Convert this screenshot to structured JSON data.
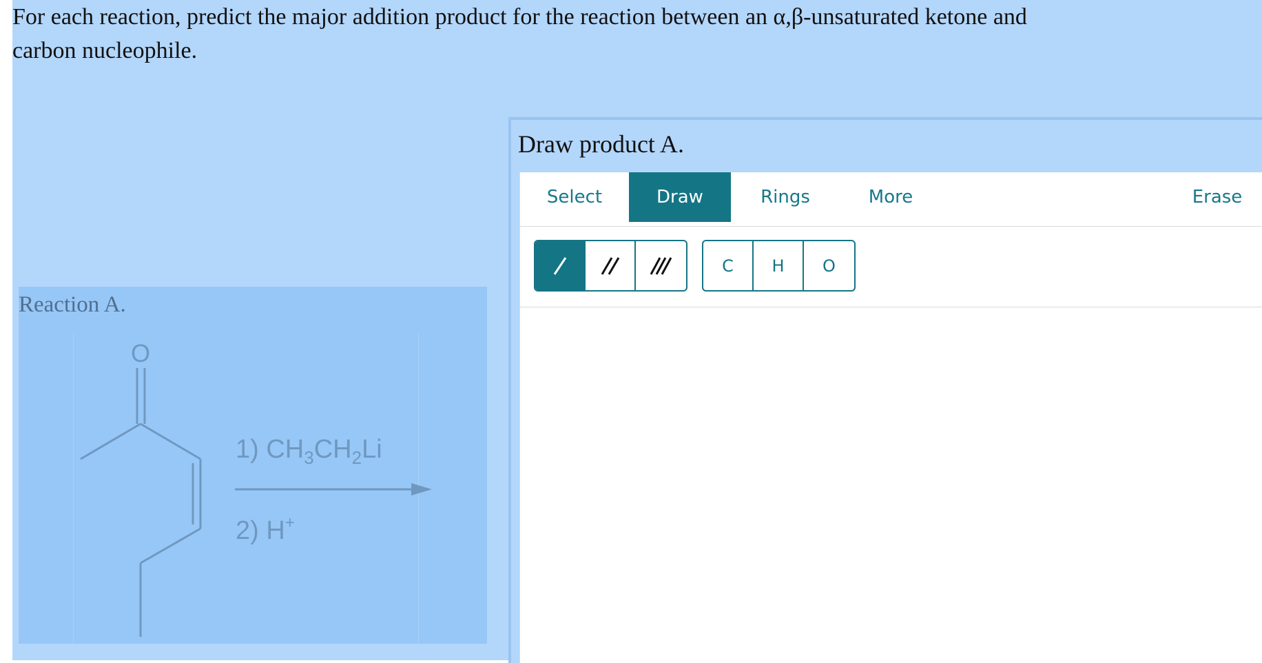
{
  "question": {
    "line1": "For each reaction, predict the major addition product for the reaction between an α,β-unsaturated ketone and",
    "line2": "carbon nucleophile."
  },
  "reaction": {
    "label": "Reaction A.",
    "atom_oxygen": "O",
    "reagent1_prefix": "1) CH",
    "reagent1_sub1": "3",
    "reagent1_mid": "CH",
    "reagent1_sub2": "2",
    "reagent1_suffix": "Li",
    "reagent2_prefix": "2) H",
    "reagent2_sup": "+"
  },
  "editor": {
    "title": "Draw product A.",
    "tabs": {
      "select": "Select",
      "draw": "Draw",
      "rings": "Rings",
      "more": "More",
      "erase": "Erase"
    },
    "active_tab": "Draw",
    "atoms": {
      "c": "C",
      "h": "H",
      "o": "O"
    },
    "bond_tools": [
      "single-bond",
      "double-bond",
      "triple-bond"
    ],
    "active_bond_tool": "single-bond"
  },
  "colors": {
    "page_background": "#b3d6fb",
    "reaction_panel": "#97c7f7",
    "accent_teal": "#147585",
    "tab_text": "#17788a"
  }
}
